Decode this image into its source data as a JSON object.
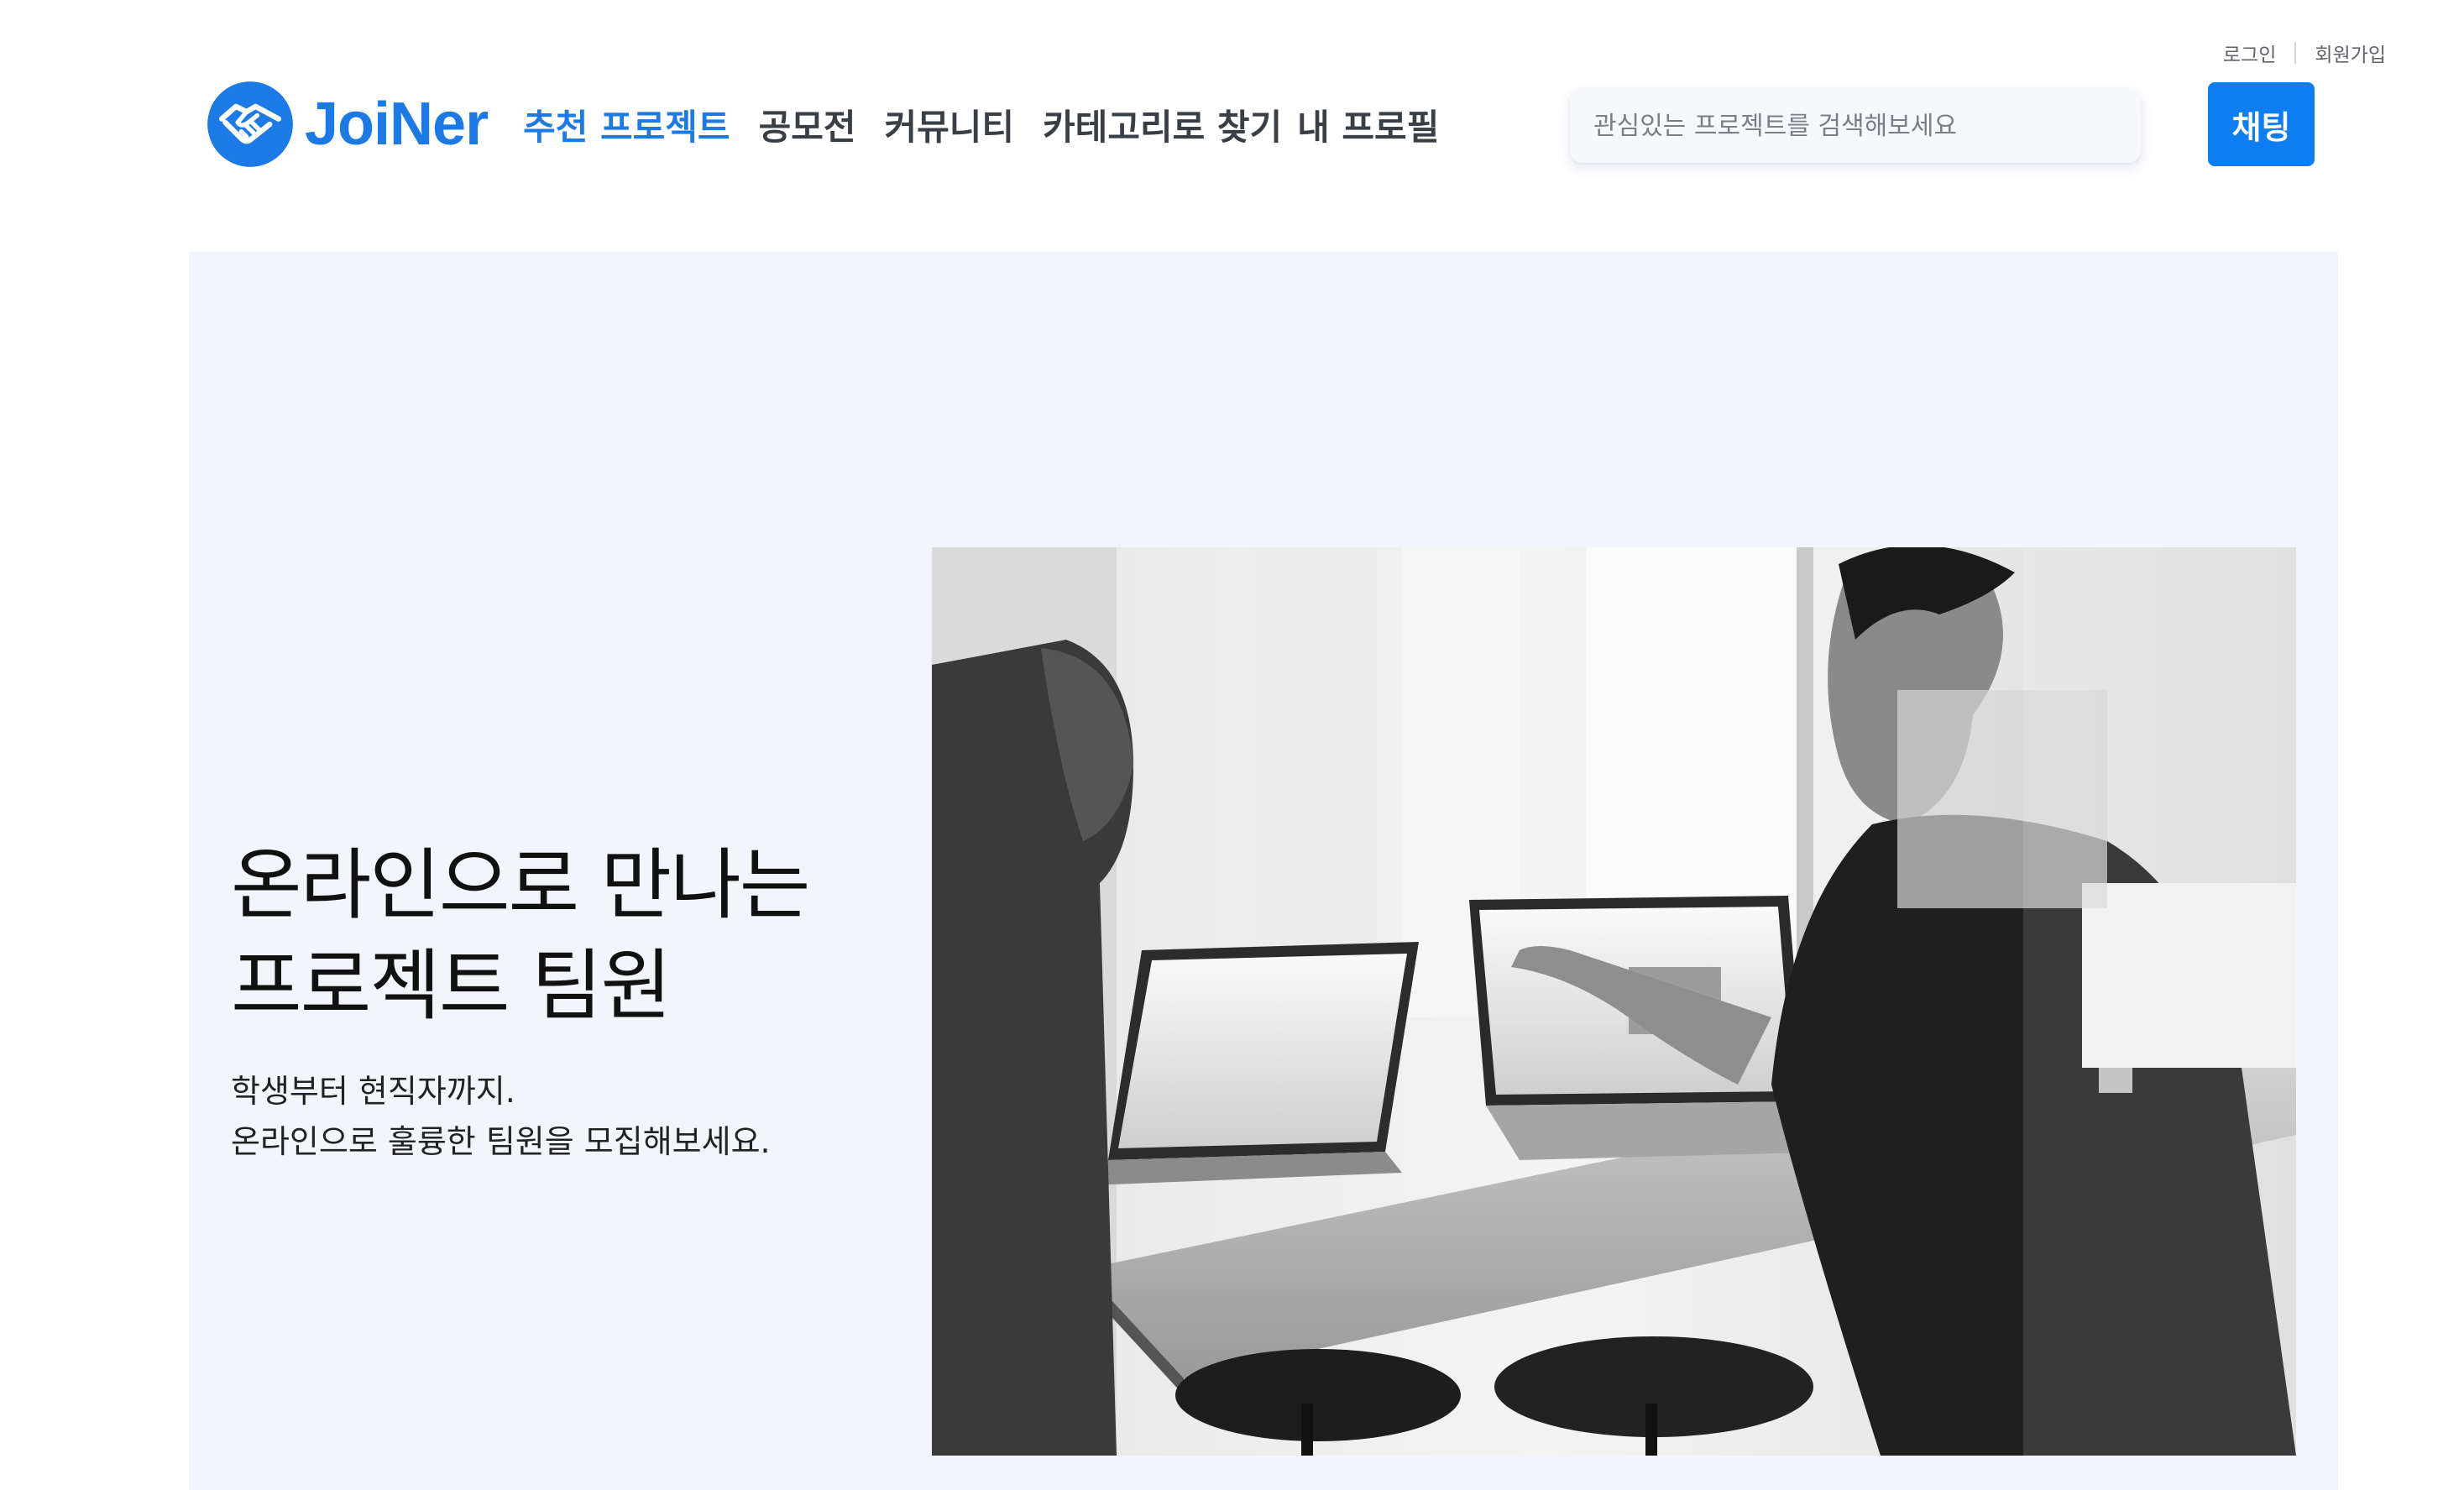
{
  "auth": {
    "login": "로그인",
    "signup": "회원가입"
  },
  "brand": {
    "name": "JoiNer",
    "accent_color": "#1c7ae6",
    "logo_icon": "handshake-icon"
  },
  "nav": {
    "items": [
      {
        "label": "추천 프로젝트",
        "active": true
      },
      {
        "label": "공모전",
        "active": false
      },
      {
        "label": "커뮤니티",
        "active": false
      },
      {
        "label": "카테고리로 찾기",
        "active": false
      },
      {
        "label": "내 프로필",
        "active": false
      }
    ]
  },
  "search": {
    "placeholder": "관심있는 프로젝트를 검색해보세요",
    "value": ""
  },
  "chat": {
    "label": "채팅",
    "color": "#0d7df2"
  },
  "hero": {
    "title_line1": "온라인으로 만나는",
    "title_line2": "프로젝트 팀원",
    "sub_line1": "학생부터 현직자까지.",
    "sub_line2": "온라인으로 훌륭한 팀원을 모집해보세요.",
    "background": "#f2f6fa",
    "photo_alt": "people-working-on-laptops-photo"
  }
}
